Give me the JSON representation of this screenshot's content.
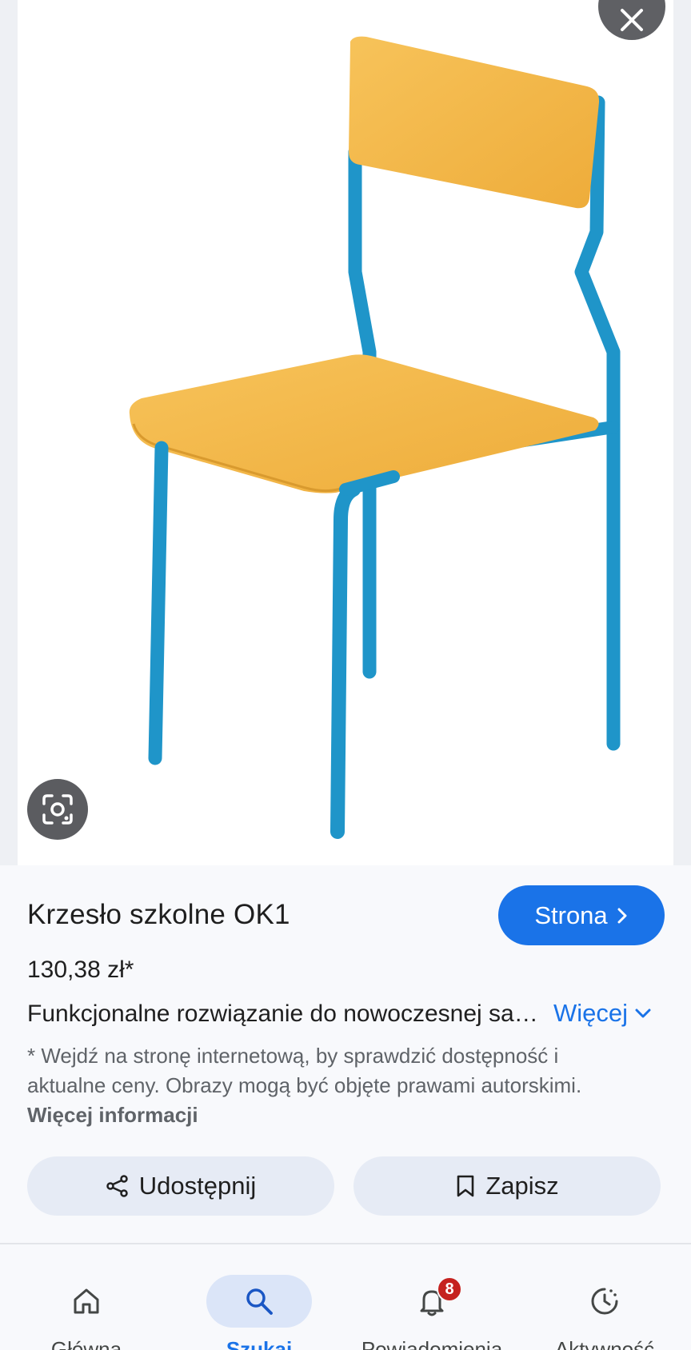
{
  "product": {
    "title": "Krzesło szkolne OK1",
    "price": "130,38 zł*",
    "description": "Funkcjonalne rozwiązanie do nowoczesnej sali lekcyjnej",
    "site_button_label": "Strona",
    "more_label": "Więcej",
    "disclaimer_text": "* Wejdź na stronę internetową, by sprawdzić dostępność i aktualne ceny. Obrazy mogą być objęte prawami autorskimi.",
    "disclaimer_link": "Więcej informacji"
  },
  "actions": {
    "share_label": "Udostępnij",
    "save_label": "Zapisz"
  },
  "nav": {
    "items": [
      {
        "label": "Główna",
        "icon": "home-icon"
      },
      {
        "label": "Szukaj",
        "icon": "search-icon",
        "active": true
      },
      {
        "label": "Powiadomienia",
        "icon": "bell-icon",
        "badge": "8"
      },
      {
        "label": "Aktywność",
        "icon": "activity-icon"
      }
    ]
  },
  "colors": {
    "accent": "#1a73e8",
    "chair_wood": "#f4b949",
    "chair_frame": "#1f95c9",
    "badge": "#c5221f"
  }
}
